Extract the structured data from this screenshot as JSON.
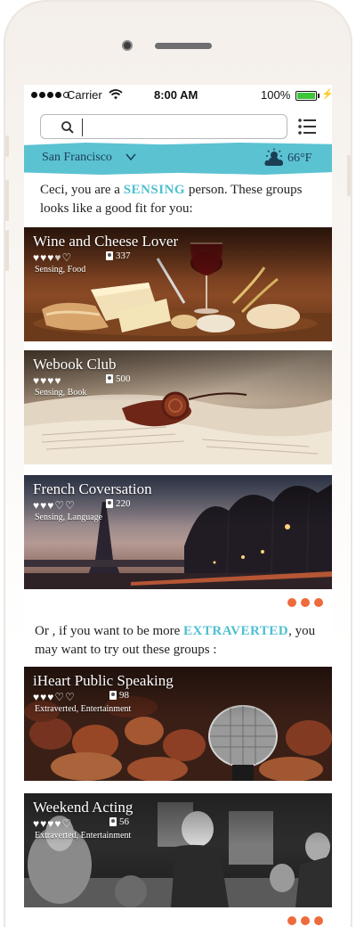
{
  "status_bar": {
    "carrier": "Carrier",
    "time": "8:00 AM",
    "battery": "100%"
  },
  "search": {
    "placeholder": "",
    "value": ""
  },
  "location": {
    "city": "San Francisco",
    "temperature": "66°F"
  },
  "intro": {
    "prefix": "Ceci, you are a ",
    "trait": "SENSING",
    "suffix": " person. These groups looks like a good fit for you:"
  },
  "groups": [
    {
      "title": "Wine and Cheese Lover",
      "rating": 4.5,
      "members": "337",
      "tags": "Sensing, Food"
    },
    {
      "title": "Webook Club",
      "rating": 4,
      "members": "500",
      "tags": "Sensing, Book"
    },
    {
      "title": "French Coversation",
      "rating": 3,
      "members": "220",
      "tags": "Sensing, Language"
    }
  ],
  "alternate": {
    "prefix": "Or , if you want to be more ",
    "trait": "EXTRAVERTED",
    "suffix": ", you may want to try out these groups :"
  },
  "alt_groups": [
    {
      "title": "iHeart Public Speaking",
      "rating": 3,
      "members": "98",
      "tags": "Extraverted, Entertainment"
    },
    {
      "title": "Weekend Acting",
      "rating": 4,
      "members": "56",
      "tags": "Extraverted, Entertainment"
    }
  ],
  "colors": {
    "accent": "#5bc2d2",
    "dots": "#ee6b3b",
    "battery": "#3ec63a"
  }
}
